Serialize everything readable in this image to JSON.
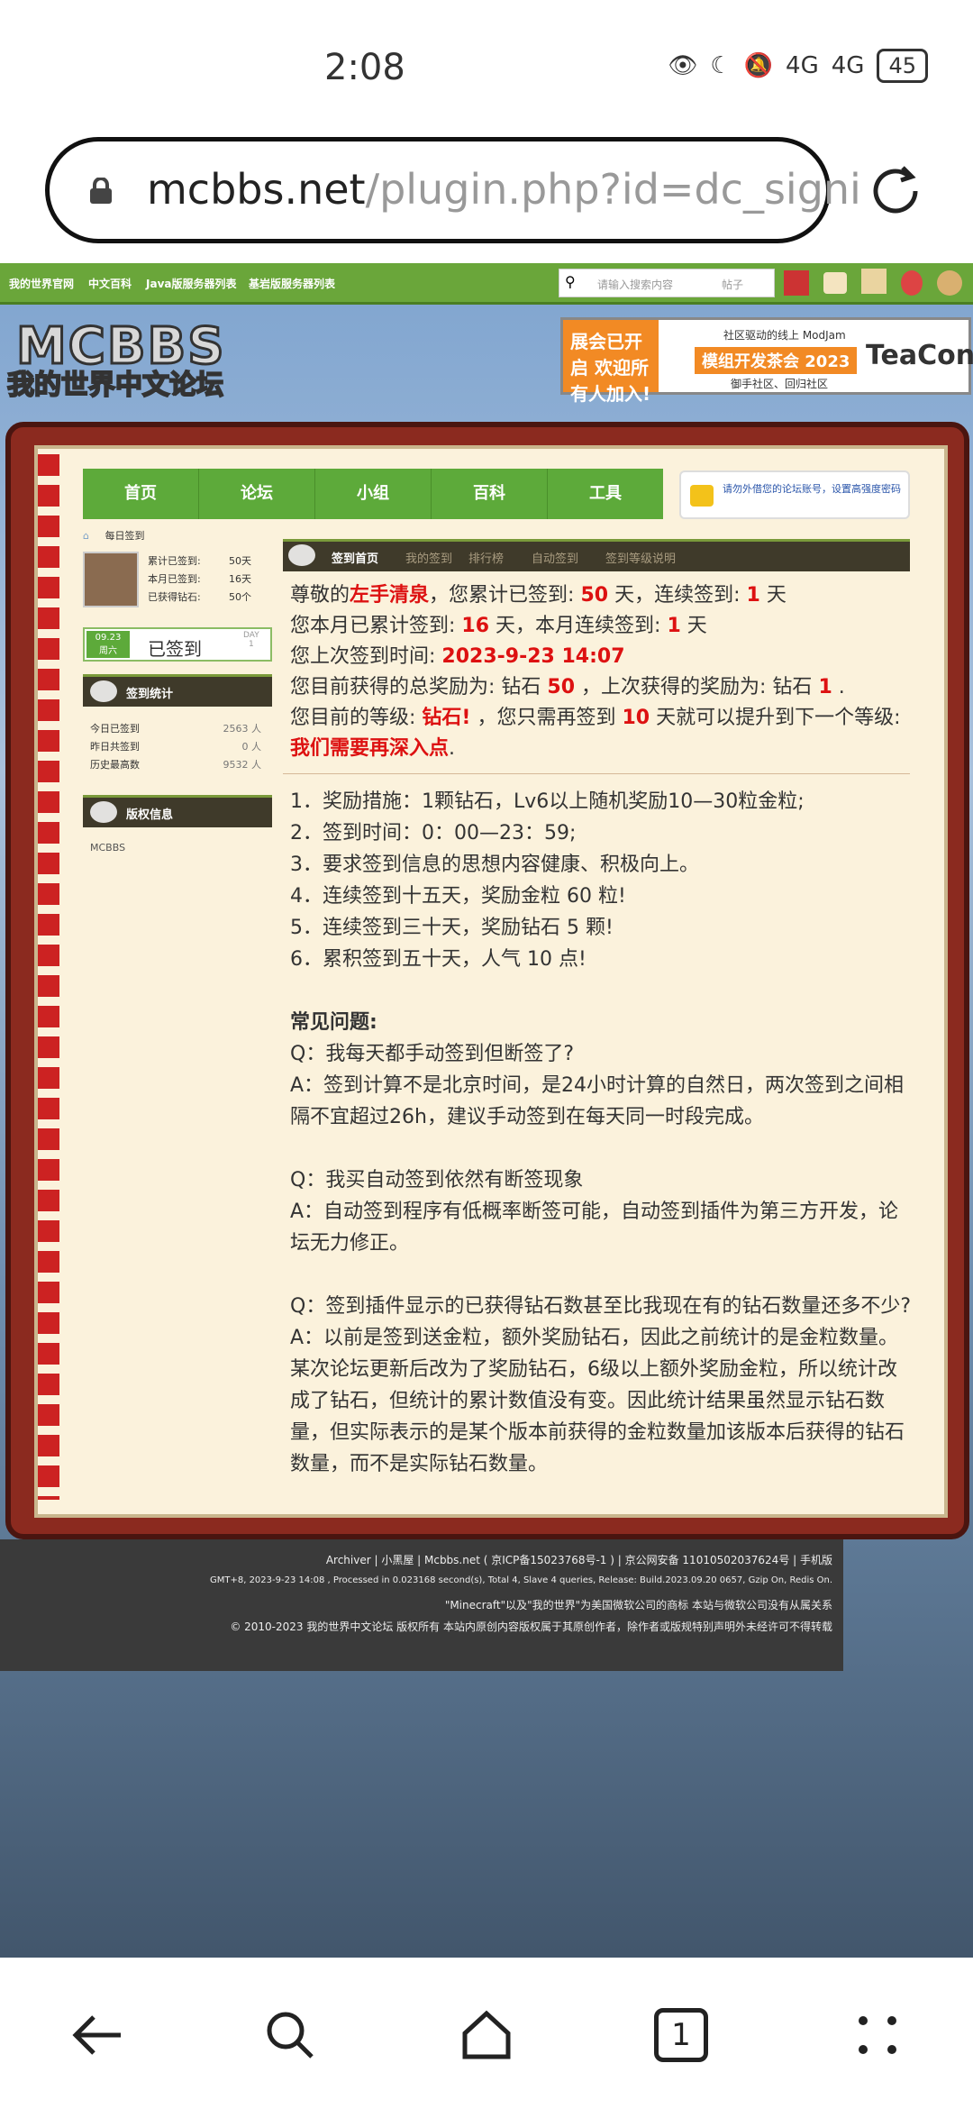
{
  "status_bar": {
    "time": "2:08",
    "battery": "45",
    "signal1": "4G",
    "signal2": "4G"
  },
  "browser": {
    "url_host": "mcbbs.net",
    "url_path": "/plugin.php?id=dc_signi",
    "tab_count": "1"
  },
  "topnav": {
    "items": [
      "我的世界官网",
      "中文百科",
      "Java版服务器列表",
      "基岩版服务器列表"
    ],
    "search_placeholder": "请输入搜索内容",
    "search_type": "帖子"
  },
  "logo": {
    "line1": "MCBBS",
    "line2": "我的世界中文论坛"
  },
  "banner": {
    "left": "展会已开启 欢迎所有人加入!",
    "top": "社区驱动的线上 ModJam",
    "mid": "模组开发茶会 2023",
    "bottom": "御手社区、回归社区",
    "brand": "TeaCon"
  },
  "main_nav": [
    "首页",
    "论坛",
    "小组",
    "百科",
    "工具"
  ],
  "notice": "请勿外借您的论坛账号，设置高强度密码",
  "breadcrumb": "每日签到",
  "user": {
    "rows": [
      {
        "label": "累计已签到:",
        "value": "50天"
      },
      {
        "label": "本月已签到:",
        "value": "16天"
      },
      {
        "label": "已获得钻石:",
        "value": "50个"
      }
    ]
  },
  "sign_button": {
    "date": "09.23",
    "weekday": "周六",
    "label": "已签到",
    "day_label": "DAY",
    "day": "1"
  },
  "stats": {
    "title": "签到统计",
    "rows": [
      {
        "label": "今日已签到",
        "value": "2563 人"
      },
      {
        "label": "昨日共签到",
        "value": "0 人"
      },
      {
        "label": "历史最高数",
        "value": "9532 人"
      }
    ]
  },
  "copyright": {
    "title": "版权信息",
    "text": "MCBBS"
  },
  "tabs": [
    "签到首页",
    "我的签到",
    "排行榜",
    "自动签到",
    "签到等级说明"
  ],
  "summary": {
    "greeting_pre": "尊敬的",
    "username": "左手清泉",
    "l1_mid": "，您累计已签到:",
    "total_days": "50",
    "l1_mid2": "天，连续签到:",
    "streak": "1",
    "l1_end": "天",
    "l2_pre": "您本月已累计签到:",
    "month_days": "16",
    "l2_mid": "天，本月连续签到:",
    "month_streak": "1",
    "l2_end": "天",
    "l3_pre": "您上次签到时间:",
    "last_time": "2023-9-23 14:07",
    "l4_pre": "您目前获得的总奖励为: 钻石",
    "total_reward": "50",
    "l4_mid": "，上次获得的奖励为: 钻石",
    "last_reward": "1",
    "l4_end": ".",
    "l5_pre": "您目前的等级:",
    "level": "钻石!",
    "l5_mid": "，您只需再签到",
    "need_days": "10",
    "l5_end": "天就可以提升到下一个等级:",
    "next_level": "我们需要再深入点",
    "l5_tail": "."
  },
  "rules": [
    "1．奖励措施：1颗钻石，Lv6以上随机奖励10—30粒金粒;",
    "2．签到时间：0：00—23：59;",
    "3．要求签到信息的思想内容健康、积极向上。",
    "4．连续签到十五天，奖励金粒 60 粒!",
    "5．连续签到三十天，奖励钻石 5 颗!",
    "6．累积签到五十天，人气 10 点!"
  ],
  "faq": {
    "title": "常见问题:",
    "q1": "Q：我每天都手动签到但断签了?",
    "a1": "A：签到计算不是北京时间，是24小时计算的自然日，两次签到之间相隔不宜超过26h，建议手动签到在每天同一时段完成。",
    "q2": "Q：我买自动签到依然有断签现象",
    "a2": "A：自动签到程序有低概率断签可能，自动签到插件为第三方开发，论坛无力修正。",
    "q3": "Q：签到插件显示的已获得钻石数甚至比我现在有的钻石数量还多不少?",
    "a3": "A：以前是签到送金粒，额外奖励钻石，因此之前统计的是金粒数量。某次论坛更新后改为了奖励钻石，6级以上额外奖励金粒，所以统计改成了钻石，但统计的累计数值没有变。因此统计结果虽然显示钻石数量，但实际表示的是某个版本前获得的金粒数量加该版本后获得的钻石数量，而不是实际钻石数量。"
  },
  "footer": [
    "Archiver | 小黑屋 | Mcbbs.net ( 京ICP备15023768号-1 ) | 京公网安备 11010502037624号 | 手机版",
    "GMT+8, 2023-9-23 14:08 , Processed in 0.023168 second(s), Total 4, Slave 4 queries, Release: Build.2023.09.20 0657, Gzip On, Redis On.",
    "\"Minecraft\"以及\"我的世界\"为美国微软公司的商标 本站与微软公司没有从属关系",
    "© 2010-2023 我的世界中文论坛 版权所有 本站内原创内容版权属于其原创作者，除作者或版规特别声明外未经许可不得转载"
  ]
}
